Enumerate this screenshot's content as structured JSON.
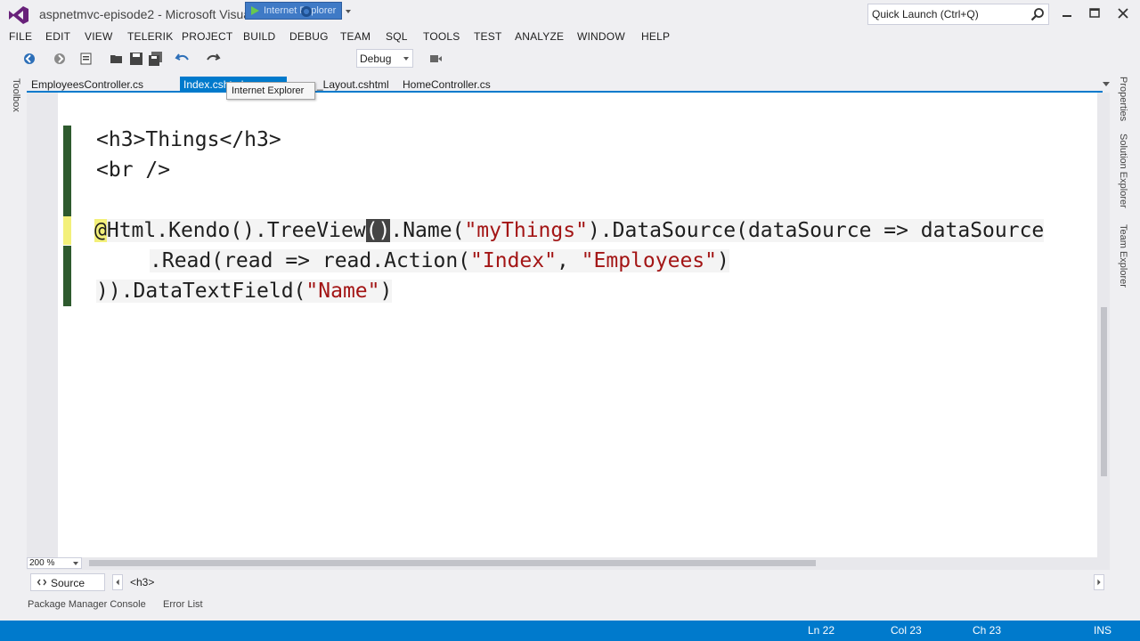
{
  "window": {
    "title": "aspnetmvc-episode2 - Microsoft Visual Studio",
    "quick_launch_placeholder": "Quick Launch (Ctrl+Q)"
  },
  "menu": [
    "FILE",
    "EDIT",
    "VIEW",
    "TELERIK",
    "PROJECT",
    "BUILD",
    "DEBUG",
    "TEAM",
    "SQL",
    "TOOLS",
    "TEST",
    "ANALYZE",
    "WINDOW",
    "HELP"
  ],
  "toolbar": {
    "run_target": "Internet Explorer",
    "configuration": "Debug"
  },
  "tabs": {
    "employees": "EmployeesController.cs",
    "index": "Index.cshtml",
    "layout": "_Layout.cshtml",
    "home": "HomeController.cs"
  },
  "tooltip": "Internet Explorer",
  "side_panels": {
    "left": "Toolbox",
    "right": [
      "Properties",
      "Solution Explorer",
      "Team Explorer"
    ]
  },
  "editor": {
    "line1": "<h3>Things</h3>",
    "line2": "<br />",
    "line3": {
      "at": "@",
      "a": "Html.Kendo().TreeView",
      "cursor": "()",
      "b": ".Name(",
      "s1": "\"myThings\"",
      "c": ").DataSource(dataSource => dataSource"
    },
    "line4": {
      "a": ".Read(read => read.Action(",
      "s1": "\"Index\"",
      "b": ", ",
      "s2": "\"Employees\"",
      "c": ")"
    },
    "line5": {
      "a": ")).DataTextField(",
      "s1": "\"Name\"",
      "b": ")"
    }
  },
  "zoom": "200 %",
  "source_view": {
    "source_label": "Source",
    "breadcrumb": "<h3>"
  },
  "bottom_tabs": [
    "Package Manager Console",
    "Error List"
  ],
  "status": {
    "ln": "Ln 22",
    "col": "Col 23",
    "ch": "Ch 23",
    "mode": "INS"
  },
  "colors": {
    "accent": "#007acc",
    "string": "#a31515",
    "change_bar": "#2e5a2e",
    "unsaved_bar": "#f3f07a"
  }
}
